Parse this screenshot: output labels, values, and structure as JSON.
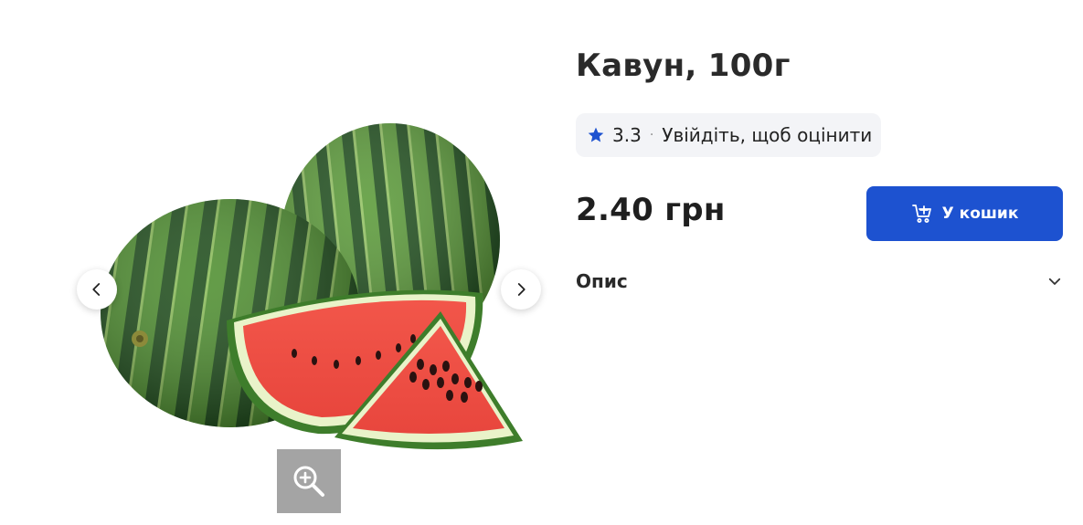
{
  "product": {
    "title": "Кавун, 100г",
    "image_alt": "watermelon",
    "price": "2.40 грн"
  },
  "rating": {
    "value": "3.3",
    "separator": "·",
    "login_prompt": "Увійдіть, щоб оцінити",
    "star_icon": "star-icon"
  },
  "actions": {
    "add_to_cart_label": "У кошик",
    "cart_icon": "cart-plus-icon"
  },
  "description": {
    "label": "Опис",
    "toggle_icon": "chevron-down-icon"
  },
  "gallery": {
    "prev_icon": "chevron-left-icon",
    "next_icon": "chevron-right-icon",
    "zoom_icon": "zoom-in-icon"
  },
  "colors": {
    "accent": "#1d52d0",
    "rating_bg": "#f3f4f7",
    "zoom_bg": "#a4a4a4"
  }
}
